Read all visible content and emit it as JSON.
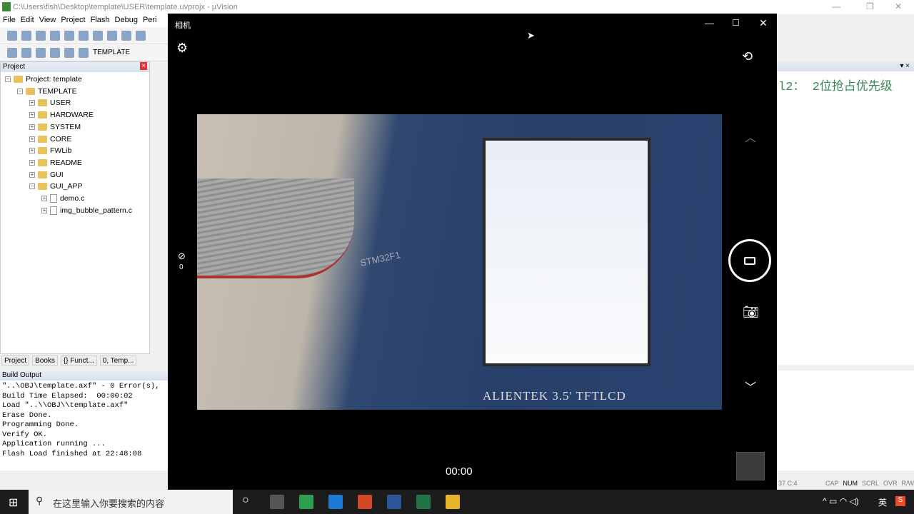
{
  "ide": {
    "title": "C:\\Users\\fish\\Desktop\\template\\USER\\template.uvprojx - µVision",
    "menu": [
      "File",
      "Edit",
      "View",
      "Project",
      "Flash",
      "Debug",
      "Peri"
    ],
    "target": "TEMPLATE",
    "project_panel_title": "Project",
    "tree": [
      {
        "label": "Project: template",
        "level": 0,
        "type": "root"
      },
      {
        "label": "TEMPLATE",
        "level": 1,
        "type": "folder"
      },
      {
        "label": "USER",
        "level": 2,
        "type": "folder"
      },
      {
        "label": "HARDWARE",
        "level": 2,
        "type": "folder"
      },
      {
        "label": "SYSTEM",
        "level": 2,
        "type": "folder"
      },
      {
        "label": "CORE",
        "level": 2,
        "type": "folder"
      },
      {
        "label": "FWLib",
        "level": 2,
        "type": "folder"
      },
      {
        "label": "README",
        "level": 2,
        "type": "folder"
      },
      {
        "label": "GUI",
        "level": 2,
        "type": "folder"
      },
      {
        "label": "GUI_APP",
        "level": 2,
        "type": "folder"
      },
      {
        "label": "demo.c",
        "level": 3,
        "type": "file"
      },
      {
        "label": "img_bubble_pattern.c",
        "level": 3,
        "type": "file"
      }
    ],
    "panel_tabs": [
      "Project",
      "Books",
      "{} Funct...",
      "0, Temp..."
    ],
    "build_title": "Build Output",
    "build_output": "\"..\\OBJ\\template.axf\" - 0 Error(s),\nBuild Time Elapsed:  00:00:02\nLoad \"..\\\\OBJ\\\\template.axf\"\nErase Done.\nProgramming Done.\nVerify OK.\nApplication running ...\nFlash Load finished at 22:48:08",
    "editor_code": "l2： 2位抢占优先级",
    "status": {
      "pos": "37 C:4",
      "cap": "CAP",
      "num": "NUM",
      "scrl": "SCRL",
      "ovr": "OVR",
      "rw": "R/W"
    }
  },
  "camera": {
    "title": "相机",
    "timer": "00:00",
    "timer_count": "0",
    "photo_text": {
      "board": "ALIENTEK 3.5' TFTLCD",
      "chip": "STM32F1"
    }
  },
  "taskbar": {
    "search_placeholder": "在这里输入你要搜索的内容",
    "ime": "英",
    "apps": [
      {
        "name": "camera",
        "color": "#555"
      },
      {
        "name": "app-green",
        "color": "#2e9e4e"
      },
      {
        "name": "edge",
        "color": "#1e78d8"
      },
      {
        "name": "powerpoint",
        "color": "#d24726"
      },
      {
        "name": "word",
        "color": "#2b579a"
      },
      {
        "name": "excel-v",
        "color": "#217346"
      },
      {
        "name": "explorer",
        "color": "#e8b52a"
      }
    ]
  }
}
